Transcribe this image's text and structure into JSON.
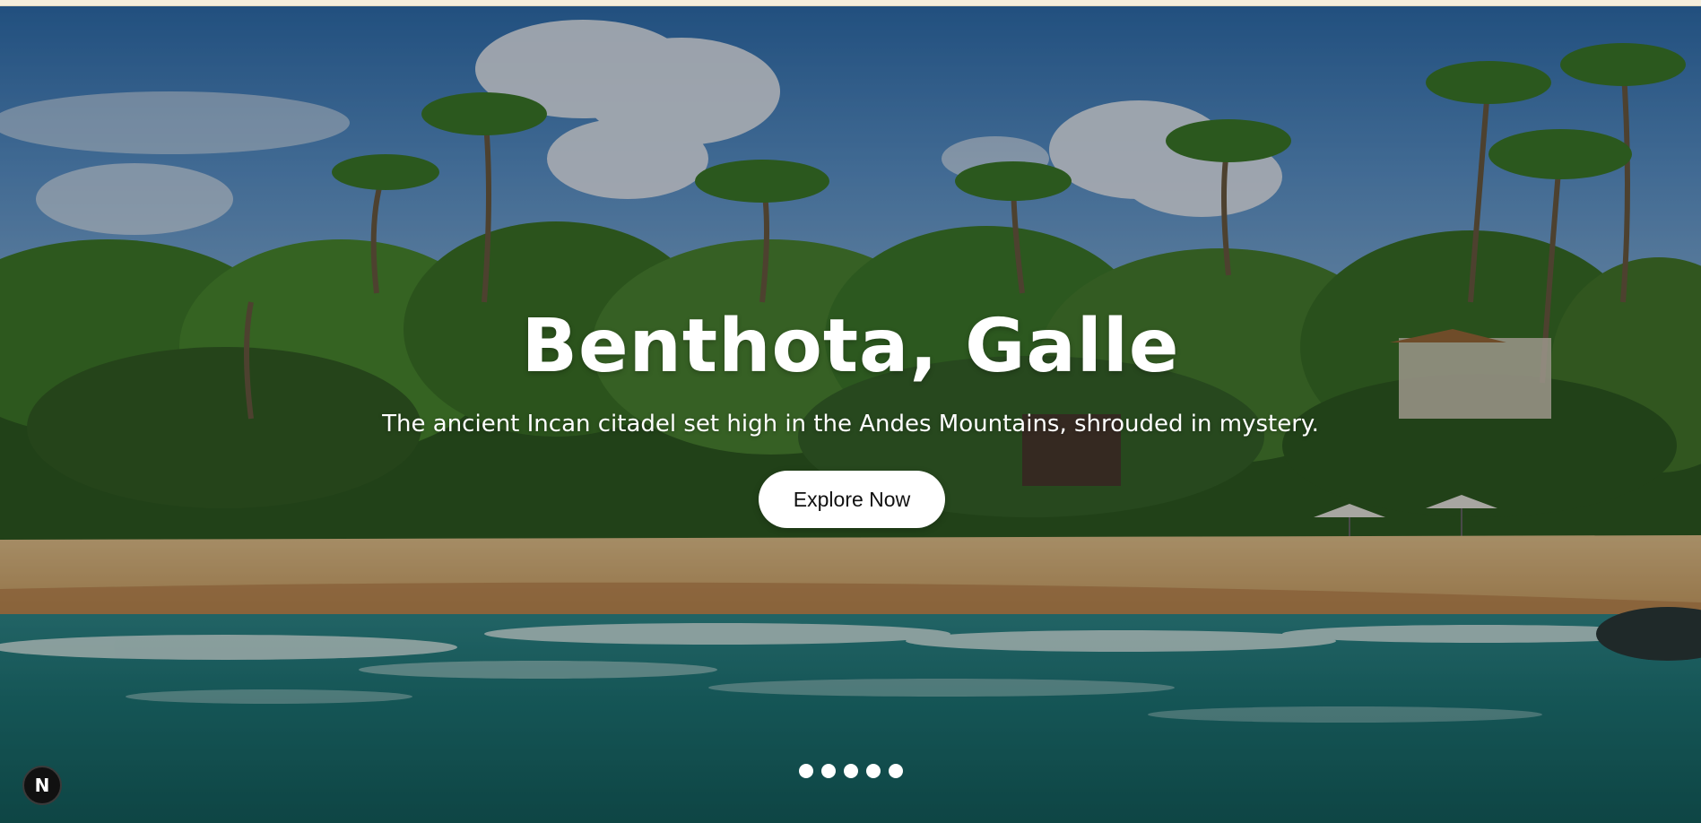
{
  "hero": {
    "title": "Benthota, Galle",
    "subtitle": "The ancient Incan citadel set high in the Andes Mountains, shrouded in mystery.",
    "cta_label": "Explore Now",
    "background_image": "tropical beach with palm trees and ocean waves"
  },
  "carousel": {
    "slide_count": 5,
    "dots": [
      "slide-1",
      "slide-2",
      "slide-3",
      "slide-4",
      "slide-5"
    ]
  },
  "dev_badge": {
    "letter": "N",
    "icon": "nextjs-logo-icon"
  },
  "colors": {
    "button_bg": "#ffffff",
    "button_text": "#111111",
    "title_text": "#ffffff",
    "badge_bg": "#111111"
  }
}
